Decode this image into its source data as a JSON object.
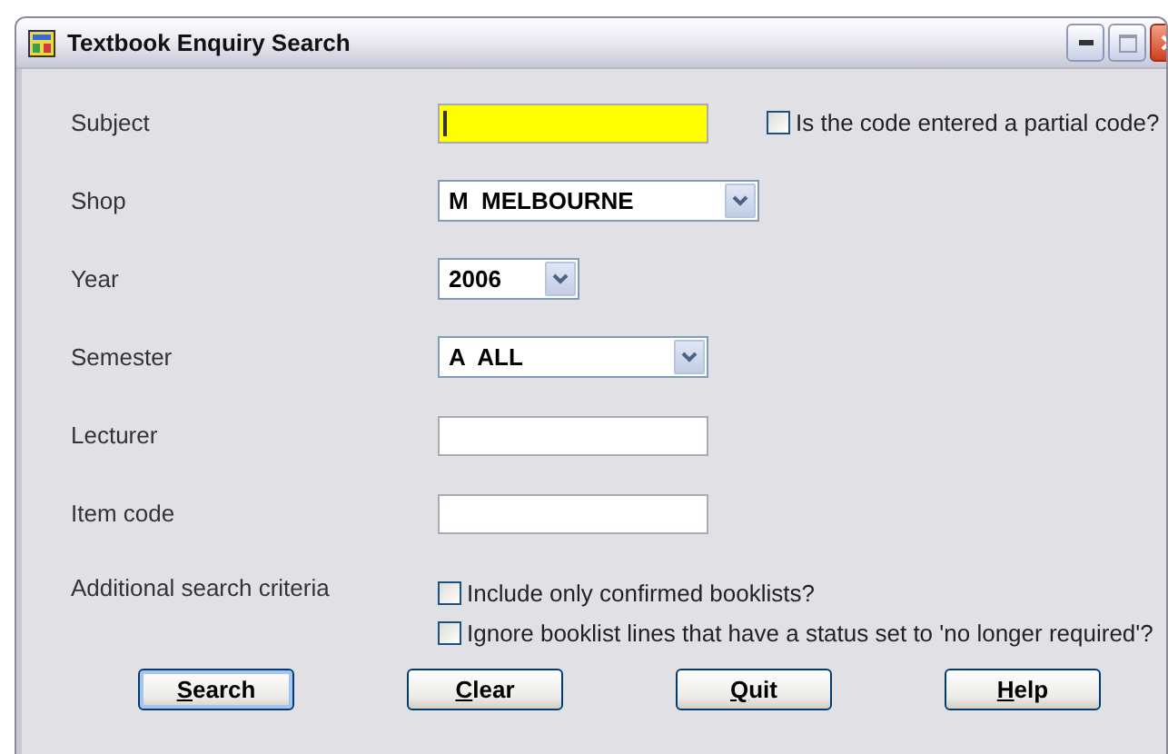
{
  "window": {
    "title": "Textbook Enquiry Search"
  },
  "fields": [
    {
      "kind": "text",
      "label": "Subject",
      "focused": true,
      "checkbox": {
        "label": "Is the code entered a partial code?",
        "checked": false
      }
    },
    {
      "kind": "combo",
      "label": "Shop",
      "value": "M  MELBOURNE"
    },
    {
      "kind": "combo",
      "label": "Year",
      "value": "2006"
    },
    {
      "kind": "combo",
      "label": "Semester",
      "value": "A  ALL"
    },
    {
      "kind": "text",
      "label": "Lecturer",
      "focused": false
    },
    {
      "kind": "text",
      "label": "Item code",
      "focused": false
    }
  ],
  "additional": {
    "label": "Additional search criteria",
    "options": [
      {
        "label": "Include only confirmed booklists?",
        "checked": false
      },
      {
        "label": "Ignore booklist lines that have a status set to 'no longer required'?",
        "checked": false
      }
    ]
  },
  "buttons": [
    {
      "key": "S",
      "rest": "earch",
      "default": true
    },
    {
      "key": "C",
      "rest": "lear",
      "default": false
    },
    {
      "key": "Q",
      "rest": "uit",
      "default": false
    },
    {
      "key": "H",
      "rest": "elp",
      "default": false
    }
  ]
}
